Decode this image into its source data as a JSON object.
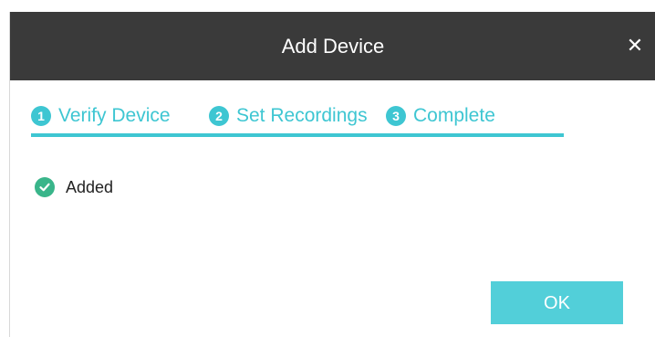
{
  "dialog": {
    "title": "Add Device",
    "close_icon": "close-icon",
    "accent_color": "#3ec6d2"
  },
  "steps": [
    {
      "number": "1",
      "label": "Verify Device"
    },
    {
      "number": "2",
      "label": "Set Recordings"
    },
    {
      "number": "3",
      "label": "Complete"
    }
  ],
  "status": {
    "icon": "check-circle-icon",
    "text": "Added",
    "color": "#39b58a"
  },
  "footer": {
    "ok_label": "OK",
    "ok_color": "#52cfd9"
  }
}
